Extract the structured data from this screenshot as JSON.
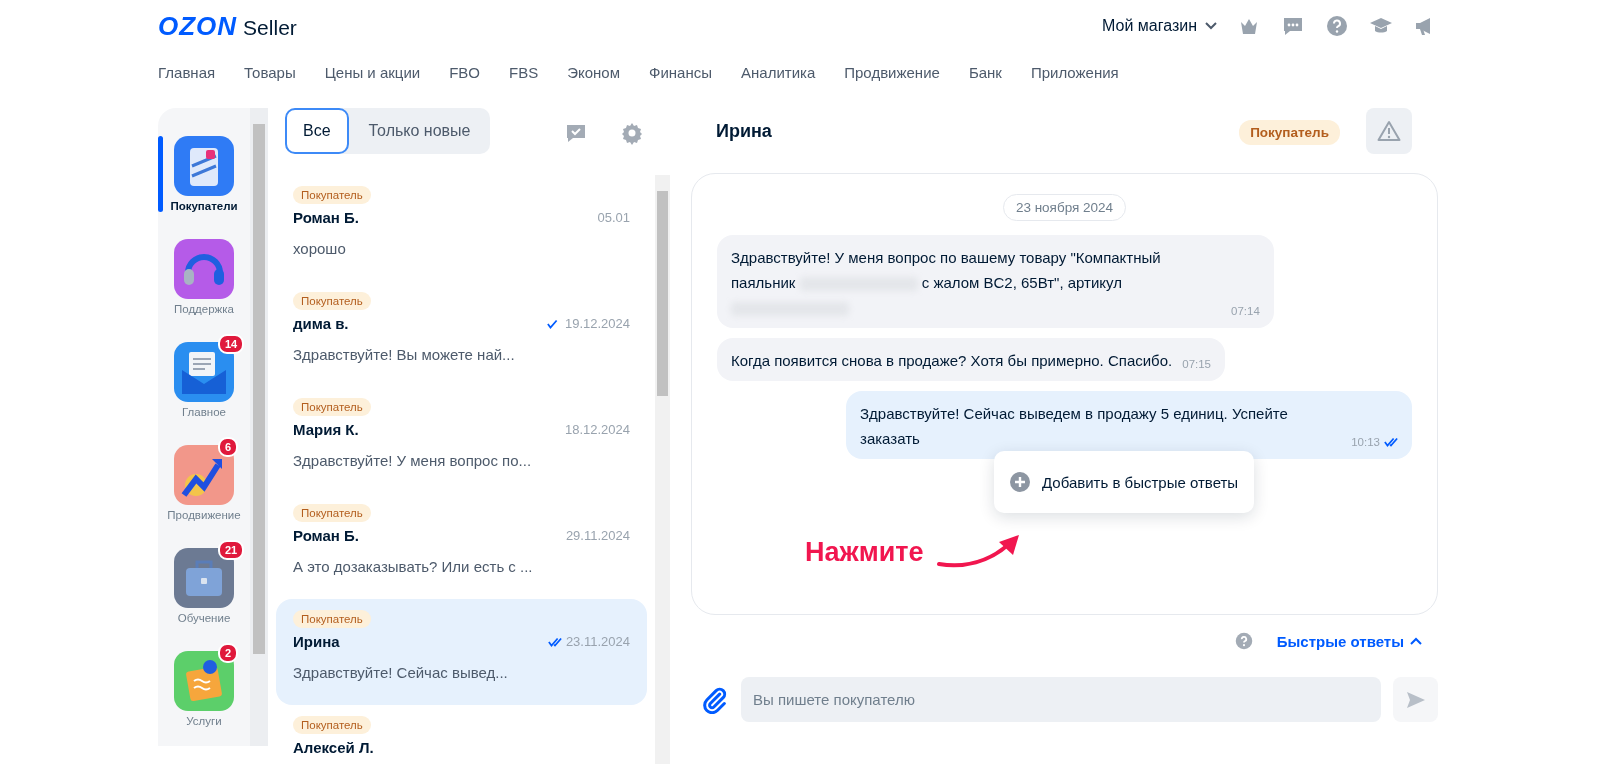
{
  "header": {
    "logo": "OZON",
    "logo_suffix": "Seller",
    "store": "Мой магазин"
  },
  "nav": [
    "Главная",
    "Товары",
    "Цены и акции",
    "FBO",
    "FBS",
    "Эконом",
    "Финансы",
    "Аналитика",
    "Продвижение",
    "Банк",
    "Приложения"
  ],
  "apps": [
    {
      "label": "Покупатели",
      "selected": true
    },
    {
      "label": "Поддержка",
      "selected": false
    },
    {
      "label": "Главное",
      "badge": "14",
      "selected": false
    },
    {
      "label": "Продвижение",
      "badge": "6",
      "selected": false
    },
    {
      "label": "Обучение",
      "badge": "21",
      "selected": false
    },
    {
      "label": "Услуги",
      "badge": "2",
      "selected": false
    }
  ],
  "filters": [
    {
      "label": "Все",
      "selected": true
    },
    {
      "label": "Только новые",
      "selected": false
    }
  ],
  "chats": [
    {
      "tag": "Покупатель",
      "name": "Роман Б.",
      "date": "05.01",
      "delivered": false,
      "read": false,
      "preview": "хорошо",
      "selected": false
    },
    {
      "tag": "Покупатель",
      "name": "дима в.",
      "date": "19.12.2024",
      "delivered": true,
      "read": false,
      "preview": "Здравствуйте! Вы можете най...",
      "selected": false
    },
    {
      "tag": "Покупатель",
      "name": "Мария К.",
      "date": "18.12.2024",
      "delivered": false,
      "read": false,
      "preview": "Здравствуйте! У меня вопрос по...",
      "selected": false
    },
    {
      "tag": "Покупатель",
      "name": "Роман Б.",
      "date": "29.11.2024",
      "delivered": false,
      "read": false,
      "preview": "А это дозаказывать? Или есть с ...",
      "selected": false
    },
    {
      "tag": "Покупатель",
      "name": "Ирина",
      "date": "23.11.2024",
      "delivered": true,
      "read": true,
      "preview": "Здравствуйте! Сейчас вывед...",
      "selected": true
    },
    {
      "tag": "Покупатель",
      "name": "Алексей Л.",
      "selected": false
    }
  ],
  "chat": {
    "name": "Ирина",
    "tag": "Покупатель",
    "date": "23 ноября 2024",
    "messages": [
      {
        "kind": "incoming",
        "parts": [
          {
            "kind": "text",
            "text": "Здравствуйте! У меня вопрос по вашему товару \"Компактный паяльник "
          },
          {
            "kind": "blurred"
          },
          {
            "kind": "text",
            "text": " с жалом BC2, 65Вт\", артикул "
          },
          {
            "kind": "blurred"
          }
        ],
        "time": "07:14"
      },
      {
        "kind": "incoming",
        "parts": [
          {
            "kind": "text",
            "text": "Когда появится снова в продаже? Хотя бы примерно. Спасибо."
          }
        ],
        "time": "07:15"
      },
      {
        "kind": "outgoing",
        "parts": [
          {
            "kind": "text",
            "text": "Здравствуйте! Сейчас выведем в продажу 5 единиц. Успейте заказать"
          }
        ],
        "time": "10:13",
        "delivered": true,
        "read": true
      }
    ]
  },
  "menu": {
    "item": "Добавить в быстрые ответы"
  },
  "annotation": "Нажмите",
  "quick_replies": {
    "label": "Быстрые ответы",
    "expanded": true
  },
  "composer": {
    "placeholder": "Вы пишете покупателю"
  }
}
